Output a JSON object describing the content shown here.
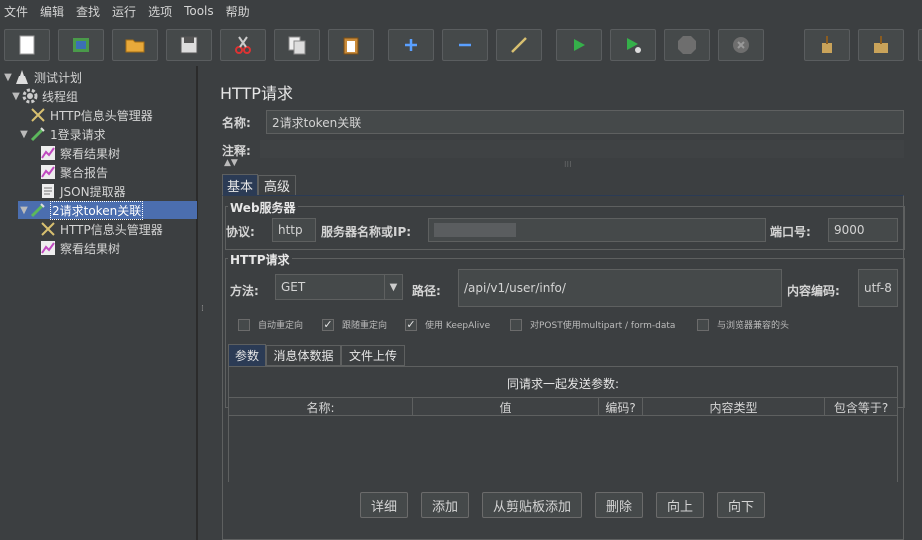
{
  "menu": [
    "文件",
    "编辑",
    "查找",
    "运行",
    "选项",
    "Tools",
    "帮助"
  ],
  "tree": {
    "root": "测试计划",
    "thread_group": "线程组",
    "items": [
      "HTTP信息头管理器",
      "1登录请求",
      "察看结果树",
      "聚合报告",
      "JSON提取器",
      "2请求token关联",
      "HTTP信息头管理器",
      "察看结果树"
    ]
  },
  "panel": {
    "title": "HTTP请求",
    "name_label": "名称:",
    "name_value": "2请求token关联",
    "comment_label": "注释:",
    "tabs": [
      "基本",
      "高级"
    ],
    "web_server_title": "Web服务器",
    "protocol_label": "协议:",
    "protocol_value": "http",
    "server_label": "服务器名称或IP:",
    "port_label": "端口号:",
    "port_value": "9000",
    "http_request_title": "HTTP请求",
    "method_label": "方法:",
    "method_value": "GET",
    "path_label": "路径:",
    "path_value": "/api/v1/user/info/",
    "encoding_label": "内容编码:",
    "encoding_value": "utf-8",
    "checkboxes": [
      {
        "label": "自动重定向",
        "checked": false
      },
      {
        "label": "跟随重定向",
        "checked": true
      },
      {
        "label": "使用 KeepAlive",
        "checked": true
      },
      {
        "label": "对POST使用multipart / form-data",
        "checked": false
      },
      {
        "label": "与浏览器兼容的头",
        "checked": false
      }
    ],
    "sub_tabs": [
      "参数",
      "消息体数据",
      "文件上传"
    ],
    "params_caption": "同请求一起发送参数:",
    "columns": [
      "名称:",
      "值",
      "编码?",
      "内容类型",
      "包含等于?"
    ],
    "buttons": [
      "详细",
      "添加",
      "从剪贴板添加",
      "删除",
      "向上",
      "向下"
    ]
  },
  "colors": {
    "bg": "#3c3f41",
    "field": "#45494a",
    "selected": "#4b6eaf",
    "tab_active": "#2b3b55"
  }
}
